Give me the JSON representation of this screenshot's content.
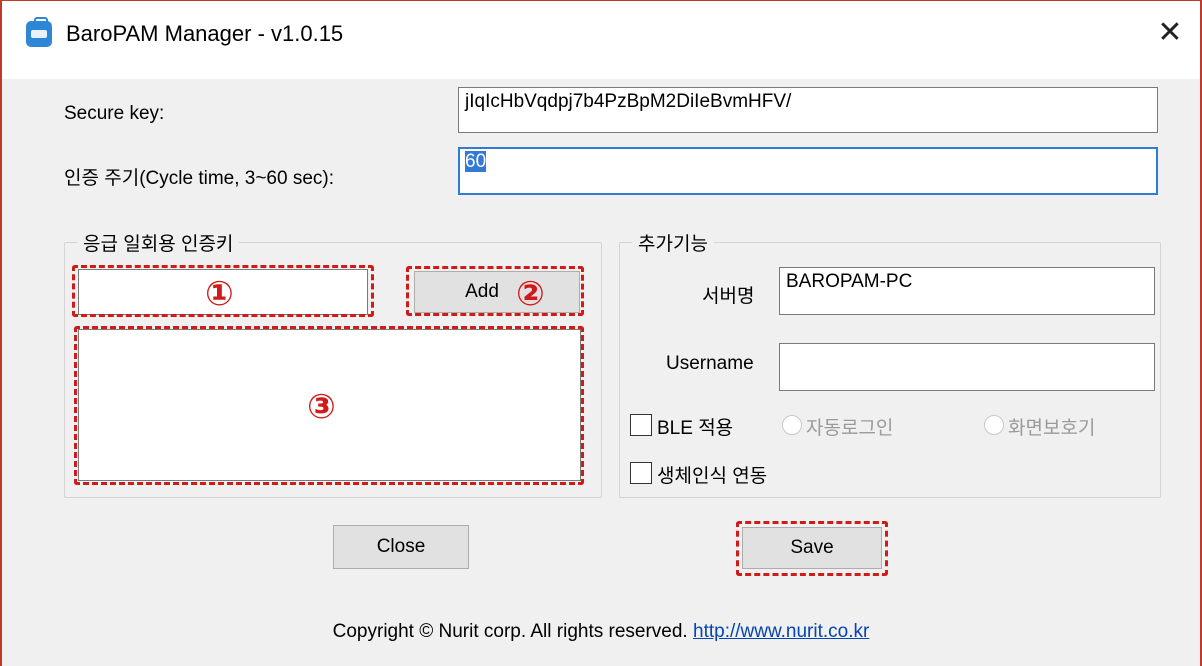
{
  "window": {
    "title": "BaroPAM Manager - v1.0.15",
    "close_glyph": "✕"
  },
  "settings": {
    "secure_key_label": "Secure key:",
    "secure_key_value": "jIqIcHbVqdpj7b4PzBpM2DiIeBvmHFV/",
    "cycle_label": "인증 주기(Cycle time, 3~60 sec):",
    "cycle_value": "60"
  },
  "emergency_group": {
    "title": "응급 일회용 인증키",
    "otp_input_value": "",
    "add_label": "Add",
    "list_items": []
  },
  "extra_group": {
    "title": "추가기능",
    "server_label": "서버명",
    "server_value": "BAROPAM-PC",
    "username_label": "Username",
    "username_value": "",
    "ble_label": "BLE 적용",
    "auto_login_label": "자동로그인",
    "screensaver_label": "화면보호기",
    "biometric_label": "생체인식 연동"
  },
  "buttons": {
    "close_label": "Close",
    "save_label": "Save"
  },
  "annotations": {
    "marker_1": "①",
    "marker_2": "②",
    "marker_3": "③"
  },
  "footer": {
    "copyright": "Copyright © Nurit corp. All rights reserved.",
    "link": "http://www.nurit.co.kr"
  },
  "colors": {
    "highlight": "#d11a1a",
    "focus": "#2e7bd6",
    "link": "#0645ad"
  }
}
